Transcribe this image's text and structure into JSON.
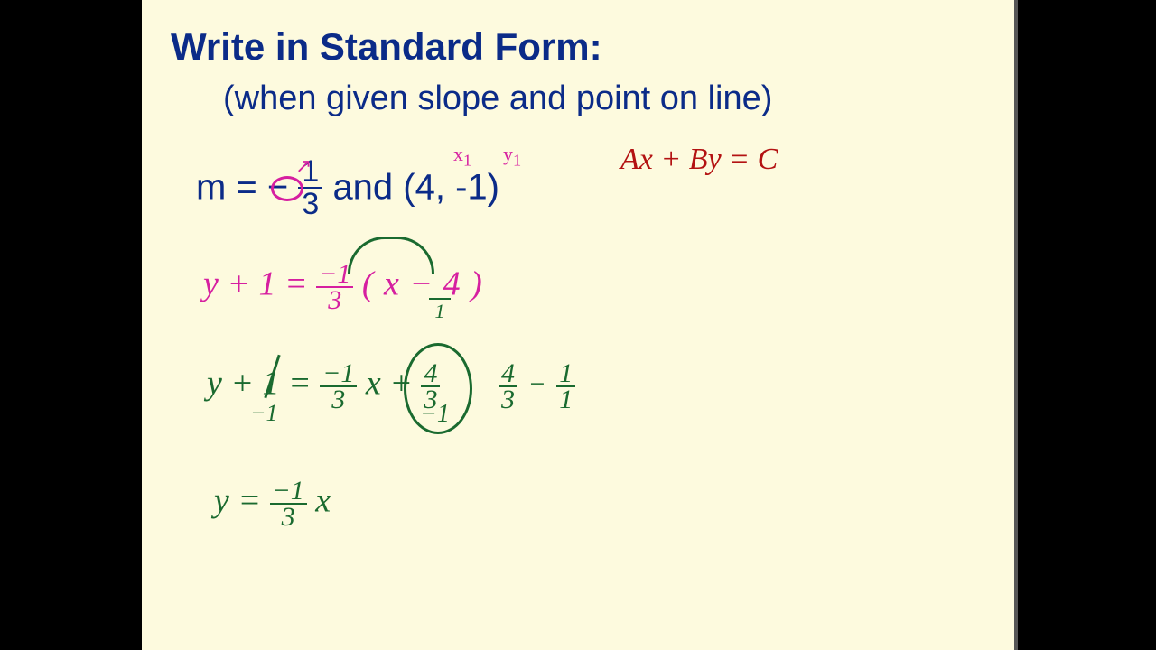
{
  "title": "Write in Standard Form:",
  "subtitle": "(when given slope and point on line)",
  "given_prefix": "m = ",
  "given_minus": "−",
  "given_num": "1",
  "given_den": "3",
  "given_mid": "  and  (",
  "given_x": "4",
  "given_comma": ", ",
  "given_y": "-1",
  "given_close": ")",
  "label_x1": "x",
  "label_x1_sub": "1",
  "label_y1": "y",
  "label_y1_sub": "1",
  "std_form": "Ax + By = C",
  "line1_left": "y + 1 =",
  "line1_frac_n": "−1",
  "line1_frac_d": "3",
  "line1_right": "( x − 4 )",
  "under_one": "1",
  "line2_a": "y + ",
  "line2_y_cancel": "1",
  "line2_eq": " = ",
  "line2_frac_n": "−1",
  "line2_frac_d": "3",
  "line2_x": "x",
  "line2_plus": " + ",
  "line2_rn": "4",
  "line2_rd": "3",
  "line2_below": "−1",
  "side_a_n": "4",
  "side_a_d": "3",
  "side_minus": "−",
  "side_b_n": "1",
  "side_b_d": "1",
  "line3_left": "y = ",
  "line3_frac_n": "−1",
  "line3_frac_d": "3",
  "line3_x": "x",
  "neg1_below_cancel": "−1"
}
